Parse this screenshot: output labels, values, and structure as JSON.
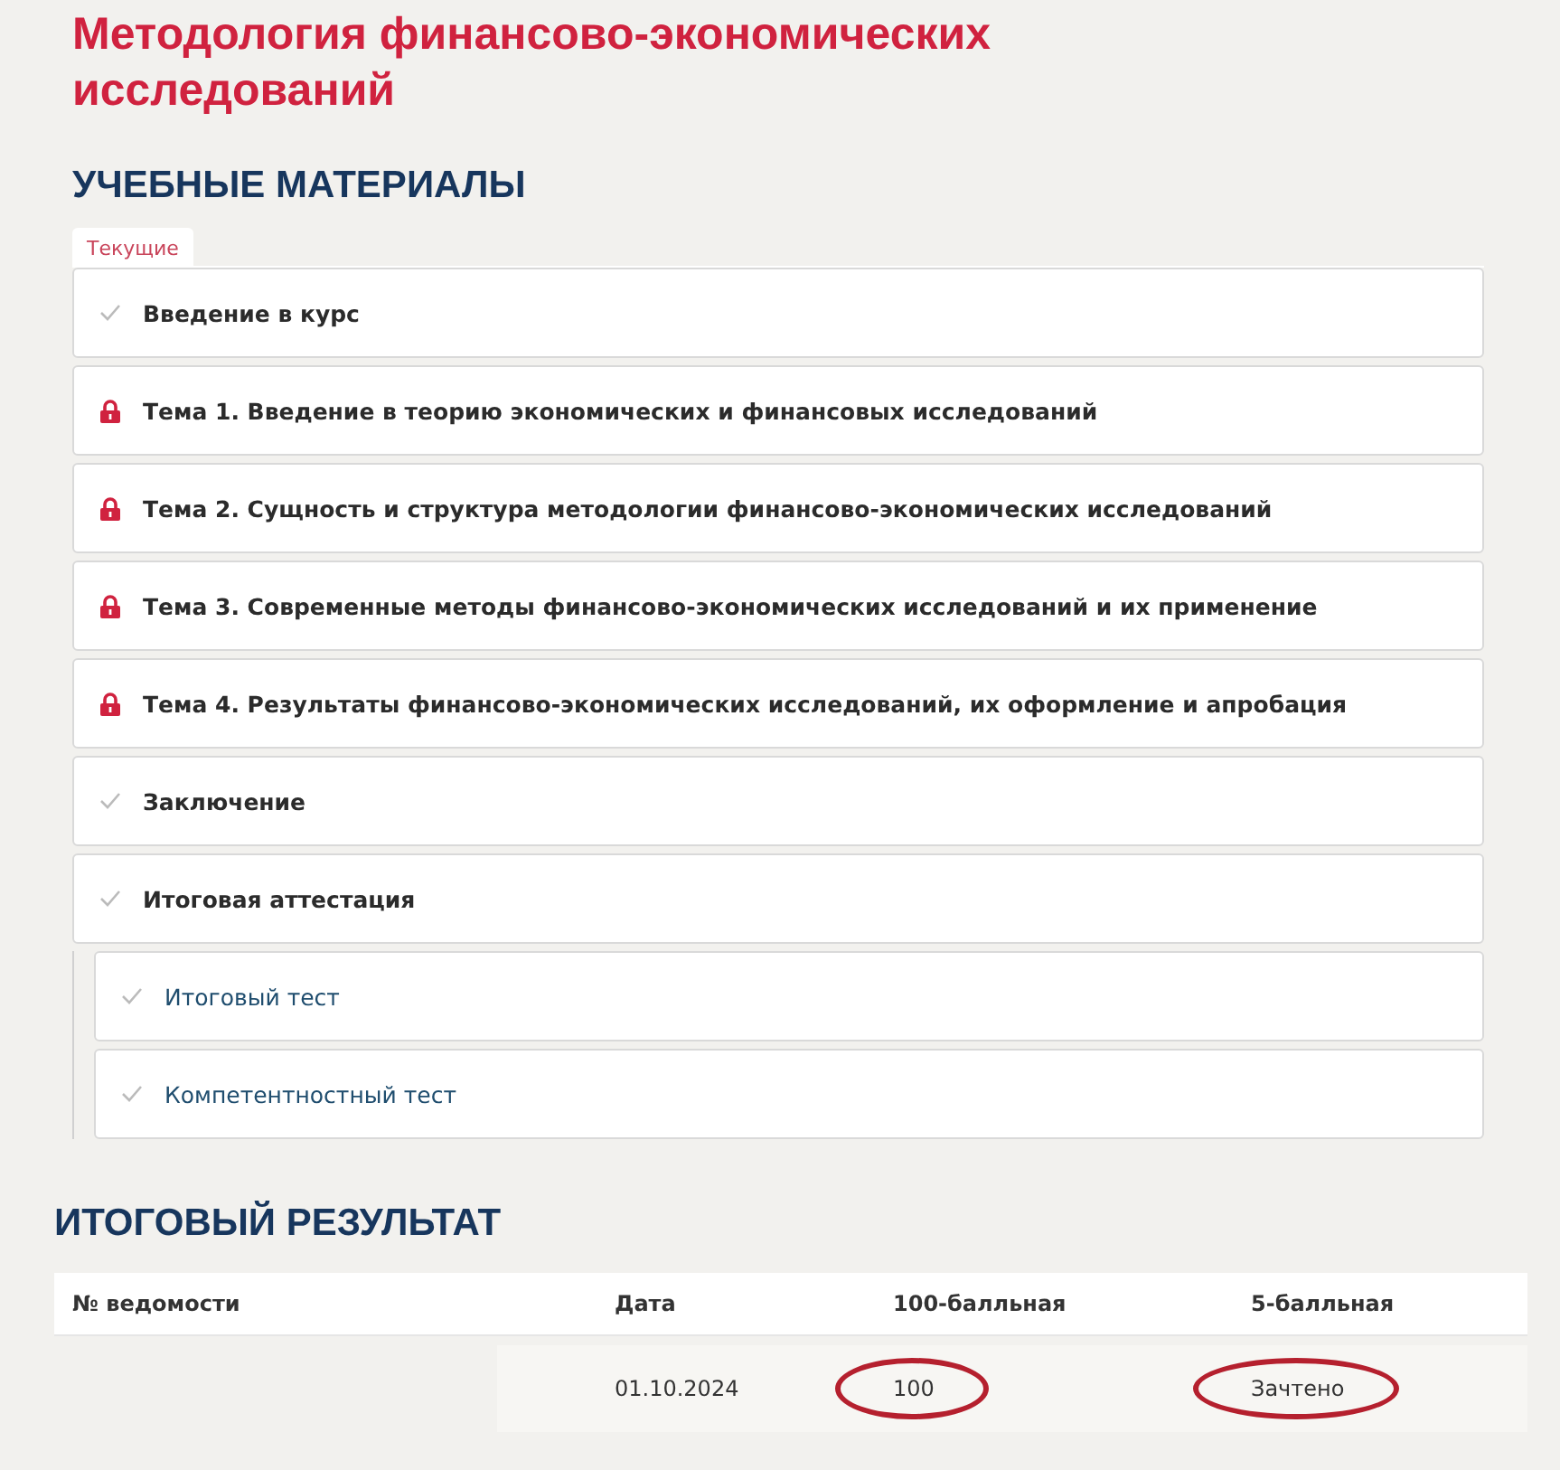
{
  "course_title": "Методология финансово-экономических исследований",
  "materials": {
    "heading": "УЧЕБНЫЕ МАТЕРИАЛЫ",
    "tabs": [
      {
        "label": "Текущие",
        "selected": true
      }
    ],
    "items": [
      {
        "label": "Введение в курс",
        "kind": "done"
      },
      {
        "label": "Тема 1. Введение в теорию экономических и финансовых исследований",
        "kind": "locked"
      },
      {
        "label": "Тема 2. Сущность и структура методологии финансово-экономических исследований",
        "kind": "locked"
      },
      {
        "label": "Тема 3. Современные методы финансово-экономических исследований и их применение",
        "kind": "locked"
      },
      {
        "label": "Тема 4. Результаты финансово-экономических исследований, их оформление и апробация",
        "kind": "locked"
      },
      {
        "label": "Заключение",
        "kind": "done"
      },
      {
        "label": "Итоговая аттестация",
        "kind": "done",
        "children": [
          {
            "label": "Итоговый тест",
            "kind": "done"
          },
          {
            "label": "Компетентностный тест",
            "kind": "done"
          }
        ]
      }
    ]
  },
  "result": {
    "heading": "ИТОГОВЫЙ РЕЗУЛЬТАТ",
    "columns": [
      "№ ведомости",
      "Дата",
      "100-балльная",
      "5-балльная"
    ],
    "rows": [
      [
        {
          "text": ""
        },
        {
          "text": "01.10.2024",
          "circled": false
        },
        {
          "text": "100",
          "circled": true
        },
        {
          "text": "Зачтено",
          "circled": true
        }
      ]
    ]
  }
}
